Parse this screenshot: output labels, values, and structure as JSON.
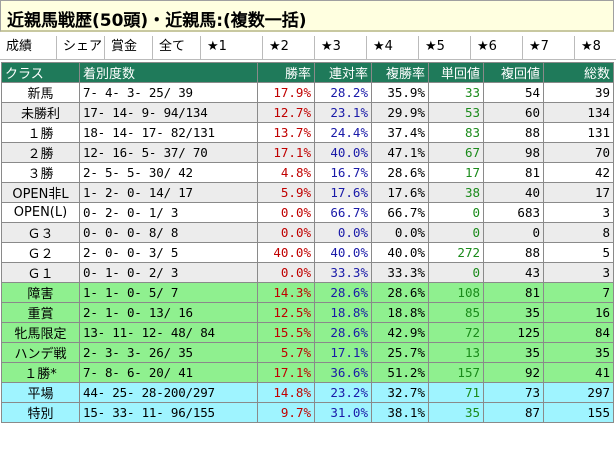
{
  "title": "近親馬戦歴(50頭)・近親馬:(複数一括)",
  "tabs": [
    "成績",
    "シェア",
    "賞金",
    "全て",
    "★1",
    "★2",
    "★3",
    "★4",
    "★5",
    "★6",
    "★7",
    "★8"
  ],
  "active_tab": "★1",
  "headers": {
    "class": "クラス",
    "counts": "着別度数",
    "win_rate": "勝率",
    "ren_rate": "連対率",
    "fuku_rate": "複勝率",
    "tan_value": "単回値",
    "fuku_value": "複回値",
    "total": "総数"
  },
  "rows": [
    {
      "cls": "新馬",
      "counts": "7- 4- 3- 25/ 39",
      "win": "17.9%",
      "ren": "28.2%",
      "fuku": "35.9%",
      "tan": "33",
      "fkv": "54",
      "total": "39",
      "style": "white"
    },
    {
      "cls": "未勝利",
      "counts": "17- 14- 9- 94/134",
      "win": "12.7%",
      "ren": "23.1%",
      "fuku": "29.9%",
      "tan": "53",
      "fkv": "60",
      "total": "134",
      "style": "alt"
    },
    {
      "cls": "１勝",
      "counts": "18- 14- 17- 82/131",
      "win": "13.7%",
      "ren": "24.4%",
      "fuku": "37.4%",
      "tan": "83",
      "fkv": "88",
      "total": "131",
      "style": "white"
    },
    {
      "cls": "２勝",
      "counts": "12- 16- 5- 37/ 70",
      "win": "17.1%",
      "ren": "40.0%",
      "fuku": "47.1%",
      "tan": "67",
      "fkv": "98",
      "total": "70",
      "style": "alt"
    },
    {
      "cls": "３勝",
      "counts": "2- 5- 5- 30/ 42",
      "win": "4.8%",
      "ren": "16.7%",
      "fuku": "28.6%",
      "tan": "17",
      "fkv": "81",
      "total": "42",
      "style": "white"
    },
    {
      "cls": "OPEN非L",
      "counts": "1- 2- 0- 14/ 17",
      "win": "5.9%",
      "ren": "17.6%",
      "fuku": "17.6%",
      "tan": "38",
      "fkv": "40",
      "total": "17",
      "style": "alt"
    },
    {
      "cls": "OPEN(L)",
      "counts": "0- 2- 0- 1/ 3",
      "win": "0.0%",
      "ren": "66.7%",
      "fuku": "66.7%",
      "tan": "0",
      "fkv": "683",
      "total": "3",
      "style": "white"
    },
    {
      "cls": "Ｇ３",
      "counts": "0- 0- 0- 8/ 8",
      "win": "0.0%",
      "ren": "0.0%",
      "fuku": "0.0%",
      "tan": "0",
      "fkv": "0",
      "total": "8",
      "style": "alt"
    },
    {
      "cls": "Ｇ２",
      "counts": "2- 0- 0- 3/ 5",
      "win": "40.0%",
      "ren": "40.0%",
      "fuku": "40.0%",
      "tan": "272",
      "fkv": "88",
      "total": "5",
      "style": "white"
    },
    {
      "cls": "Ｇ１",
      "counts": "0- 1- 0- 2/ 3",
      "win": "0.0%",
      "ren": "33.3%",
      "fuku": "33.3%",
      "tan": "0",
      "fkv": "43",
      "total": "3",
      "style": "alt"
    },
    {
      "cls": "障害",
      "counts": "1- 1- 0- 5/ 7",
      "win": "14.3%",
      "ren": "28.6%",
      "fuku": "28.6%",
      "tan": "108",
      "fkv": "81",
      "total": "7",
      "style": "green"
    },
    {
      "cls": "重賞",
      "counts": "2- 1- 0- 13/ 16",
      "win": "12.5%",
      "ren": "18.8%",
      "fuku": "18.8%",
      "tan": "85",
      "fkv": "35",
      "total": "16",
      "style": "green"
    },
    {
      "cls": "牝馬限定",
      "counts": "13- 11- 12- 48/ 84",
      "win": "15.5%",
      "ren": "28.6%",
      "fuku": "42.9%",
      "tan": "72",
      "fkv": "125",
      "total": "84",
      "style": "green"
    },
    {
      "cls": "ハンデ戦",
      "counts": "2- 3- 3- 26/ 35",
      "win": "5.7%",
      "ren": "17.1%",
      "fuku": "25.7%",
      "tan": "13",
      "fkv": "35",
      "total": "35",
      "style": "green"
    },
    {
      "cls": "１勝*",
      "counts": "7- 8- 6- 20/ 41",
      "win": "17.1%",
      "ren": "36.6%",
      "fuku": "51.2%",
      "tan": "157",
      "fkv": "92",
      "total": "41",
      "style": "green"
    },
    {
      "cls": "平場",
      "counts": "44- 25- 28-200/297",
      "win": "14.8%",
      "ren": "23.2%",
      "fuku": "32.7%",
      "tan": "71",
      "fkv": "73",
      "total": "297",
      "style": "cyan"
    },
    {
      "cls": "特別",
      "counts": "15- 33- 11- 96/155",
      "win": "9.7%",
      "ren": "31.0%",
      "fuku": "38.1%",
      "tan": "35",
      "fkv": "87",
      "total": "155",
      "style": "cyan"
    }
  ]
}
